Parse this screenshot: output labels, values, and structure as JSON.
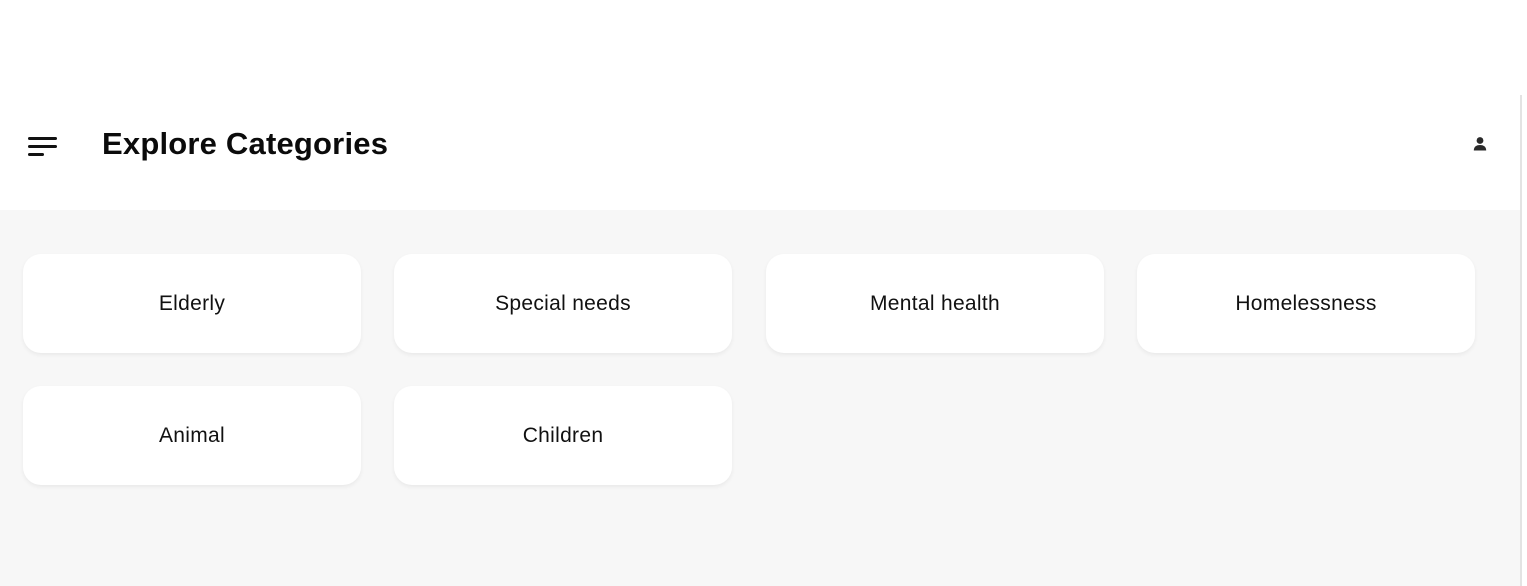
{
  "header": {
    "title": "Explore Categories",
    "menu_icon": "hamburger-menu-icon",
    "profile_icon": "user-icon"
  },
  "categories": [
    {
      "label": "Elderly"
    },
    {
      "label": "Special needs"
    },
    {
      "label": "Mental health"
    },
    {
      "label": "Homelessness"
    },
    {
      "label": "Animal"
    },
    {
      "label": "Children"
    }
  ],
  "colors": {
    "page_background": "#f7f7f7",
    "header_background": "#ffffff",
    "card_background": "#ffffff",
    "text": "#111111"
  }
}
